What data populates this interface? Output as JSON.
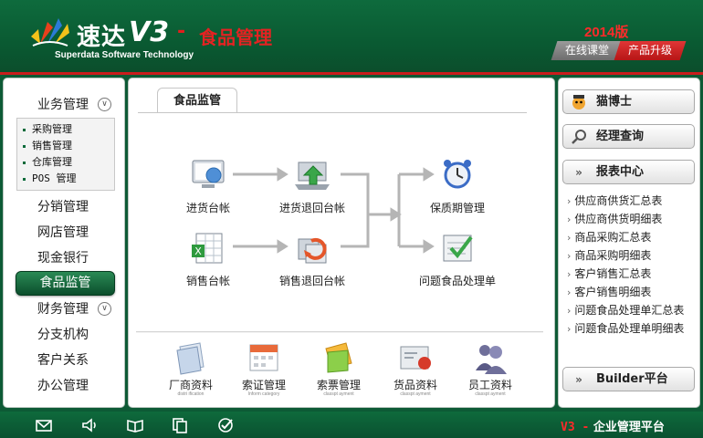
{
  "header": {
    "logo_cn": "速达",
    "logo_v3": "V3",
    "logo_dash": "-",
    "product_name": "食品管理",
    "logo_en": "Superdata Software Technology",
    "year": "2014版",
    "online_class": "在线课堂",
    "upgrade": "产品升级",
    "colors": {
      "brand_green": "#0b5e35",
      "accent_red": "#e52222"
    }
  },
  "sidebar": {
    "business": "业务管理",
    "sub_items": [
      "采购管理",
      "销售管理",
      "仓库管理",
      "POS 管理"
    ],
    "items": [
      "分销管理",
      "网店管理",
      "现金银行",
      "食品监管",
      "财务管理",
      "分支机构",
      "客户关系",
      "办公管理"
    ],
    "active": "食品监管"
  },
  "main": {
    "tab": "食品监管",
    "flow": {
      "purchase_ledger": "进货台帐",
      "purchase_return_ledger": "进货退回台帐",
      "shelf_life": "保质期管理",
      "sales_ledger": "销售台帐",
      "sales_return_ledger": "销售退回台帐",
      "problem_food": "问题食品处理单"
    },
    "bottom": [
      {
        "label": "厂商资料",
        "sub": "distri ification"
      },
      {
        "label": "索证管理",
        "sub": "Inform category"
      },
      {
        "label": "索票管理",
        "sub": "classpt ayment"
      },
      {
        "label": "货品资料",
        "sub": "classpt ayment"
      },
      {
        "label": "员工资料",
        "sub": "classpt ayment"
      }
    ]
  },
  "right": {
    "doctor": "猫博士",
    "manager_query": "经理查询",
    "report_center": "报表中心",
    "reports": [
      "供应商供货汇总表",
      "供应商供货明细表",
      "商品采购汇总表",
      "商品采购明细表",
      "客户销售汇总表",
      "客户销售明细表",
      "问题食品处理单汇总表",
      "问题食品处理单明细表"
    ],
    "builder": "Builder平台"
  },
  "footer": {
    "icons": [
      "mail-icon",
      "speaker-icon",
      "book-icon",
      "copy-icon",
      "check-icon"
    ],
    "brand_v3": "V3 -",
    "brand_text": "企业管理平台"
  }
}
